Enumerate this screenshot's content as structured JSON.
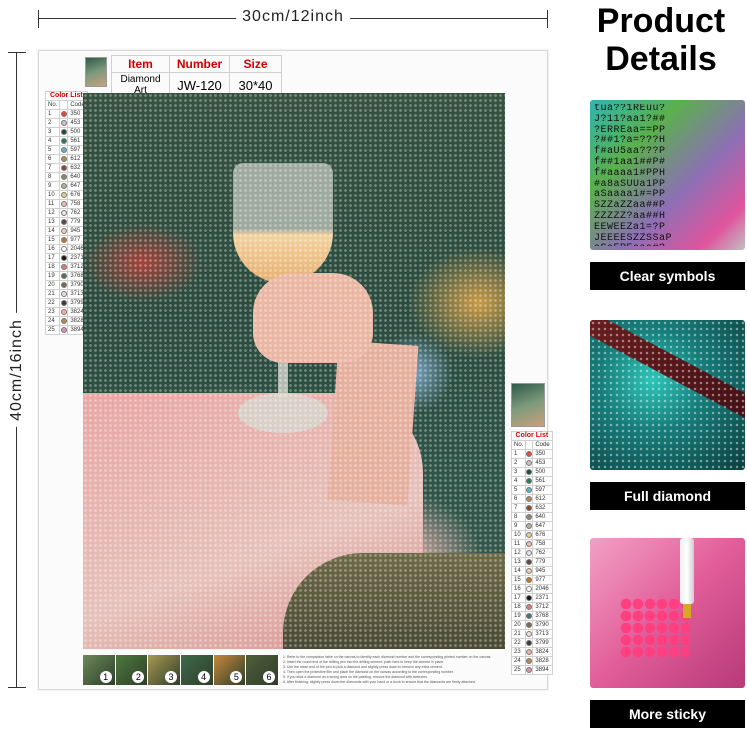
{
  "dimensions": {
    "width_label": "30cm/12inch",
    "height_label": "40cm/16inch"
  },
  "product_table": {
    "headers": [
      "Item",
      "Number",
      "Size"
    ],
    "values": [
      "Diamond Art",
      "JW-120",
      "30*40"
    ]
  },
  "color_list": {
    "title": "Color List",
    "header_no": "No.",
    "header_code": "Code",
    "rows": [
      {
        "no": "1",
        "code": "350",
        "color": "#e04a3c"
      },
      {
        "no": "2",
        "code": "453",
        "color": "#d6b8c8"
      },
      {
        "no": "3",
        "code": "500",
        "color": "#1f4e3d"
      },
      {
        "no": "4",
        "code": "561",
        "color": "#2e7a57"
      },
      {
        "no": "5",
        "code": "597",
        "color": "#5fb6c0"
      },
      {
        "no": "6",
        "code": "612",
        "color": "#a88f5a"
      },
      {
        "no": "7",
        "code": "632",
        "color": "#8a4a35"
      },
      {
        "no": "8",
        "code": "640",
        "color": "#8c8673"
      },
      {
        "no": "9",
        "code": "647",
        "color": "#b2ae9a"
      },
      {
        "no": "10",
        "code": "676",
        "color": "#e4cc8a"
      },
      {
        "no": "11",
        "code": "758",
        "color": "#f0b8a8"
      },
      {
        "no": "12",
        "code": "762",
        "color": "#e5e5e5"
      },
      {
        "no": "13",
        "code": "779",
        "color": "#5c4a48"
      },
      {
        "no": "14",
        "code": "945",
        "color": "#f2cdb0"
      },
      {
        "no": "15",
        "code": "977",
        "color": "#c6782a"
      },
      {
        "no": "16",
        "code": "2046",
        "color": "#ffffff"
      },
      {
        "no": "17",
        "code": "2371",
        "color": "#1a1a1a"
      },
      {
        "no": "18",
        "code": "3712",
        "color": "#e07878"
      },
      {
        "no": "19",
        "code": "3768",
        "color": "#4a7272"
      },
      {
        "no": "20",
        "code": "3790",
        "color": "#7a6a58"
      },
      {
        "no": "21",
        "code": "3713",
        "color": "#f8dcd8"
      },
      {
        "no": "22",
        "code": "3799",
        "color": "#3a3a3a"
      },
      {
        "no": "23",
        "code": "3824",
        "color": "#f5b09a"
      },
      {
        "no": "24",
        "code": "3828",
        "color": "#b58a55"
      },
      {
        "no": "25",
        "code": "3894",
        "color": "#dd8fb0"
      }
    ]
  },
  "steps": [
    "1",
    "2",
    "3",
    "4",
    "5",
    "6"
  ],
  "instructions": [
    "1. Refer to the comparison table on the canvas to identify each diamond number and the corresponding printed number on the canvas.",
    "2. Insert the round end of the drilling pen into the drilling cement, push hard to keep the cement in place.",
    "3. Use the clean end of the pen to pick a diamond and slightly press down to remove any extra cement.",
    "4. Then open the protective film and place the diamond on the canvas according to the corresponding number.",
    "5. If you stick a diamond on a wrong area on the painting, remove the diamond with tweezers.",
    "6. After finishing, slightly press down the diamonds with your hand or a book to ensure that the diamonds are firmly attached."
  ],
  "product_details": {
    "title_line1": "Product",
    "title_line2": "Details",
    "features": [
      {
        "label": "Clear symbols"
      },
      {
        "label": "Full diamond"
      },
      {
        "label": "More sticky"
      }
    ],
    "symbol_rows": [
      "tua??1REuu?",
      "J?11?aa1?##",
      "?ERREaa==PP",
      "?##1?a=???H",
      "f#aU5aa???P",
      "f##1aa1##P#",
      "f#aaaa1#PPH",
      "#a8aSUUa1PP",
      "aSaaaa1#=PP",
      "SZZaZZaa##P",
      "ZZZZZ?aa##H",
      "EEWEEZa1=?P",
      "JEEEESZZSSaP",
      "aSaEREaaa#?"
    ]
  }
}
